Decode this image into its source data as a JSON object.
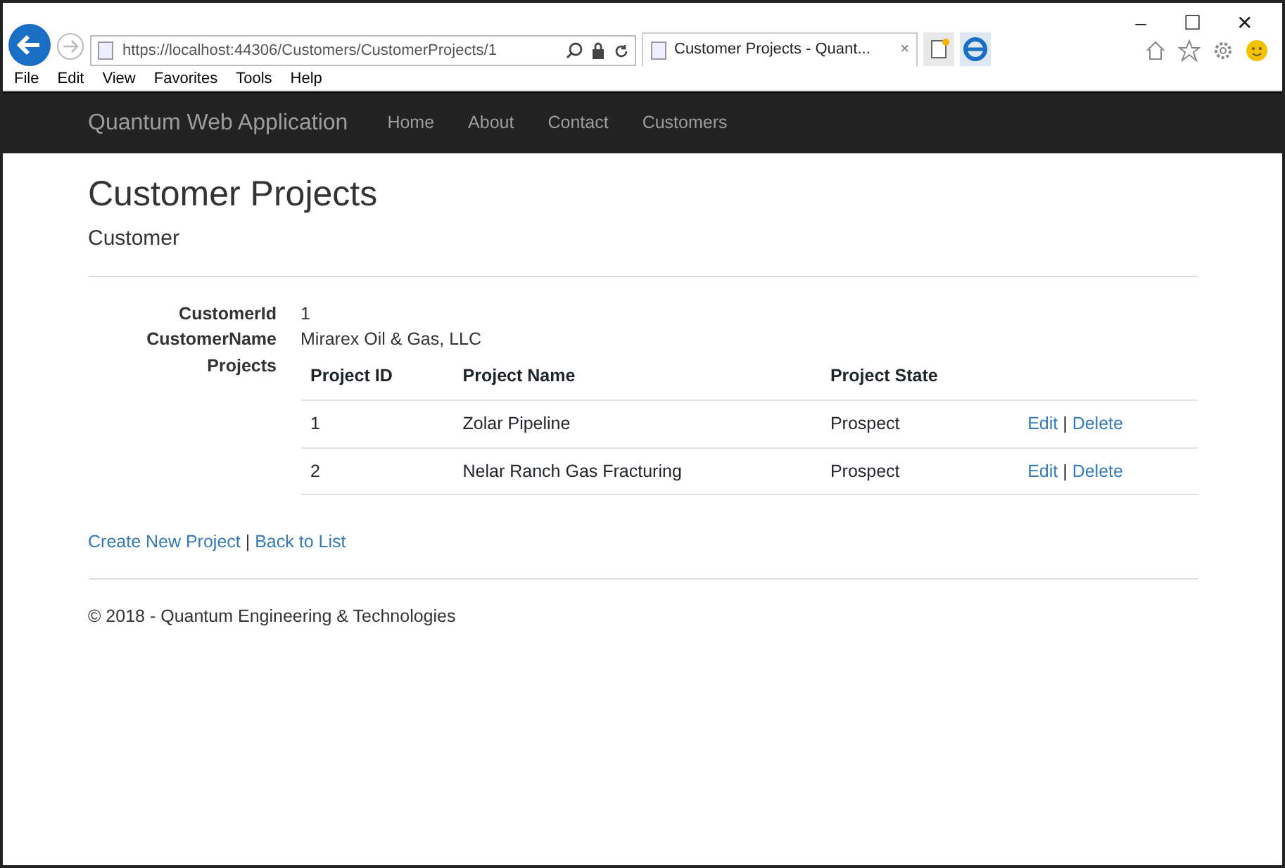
{
  "browser": {
    "address": "https://localhost:44306/Customers/CustomerProjects/1",
    "tab_title": "Customer Projects - Quant...",
    "tab_close": "×",
    "window_controls": [
      "–",
      "☐",
      "✕"
    ],
    "menu": [
      "File",
      "Edit",
      "View",
      "Favorites",
      "Tools",
      "Help"
    ]
  },
  "navbar": {
    "brand": "Quantum Web Application",
    "links": [
      "Home",
      "About",
      "Contact",
      "Customers"
    ]
  },
  "page": {
    "title": "Customer Projects",
    "subtitle": "Customer",
    "fields": [
      {
        "label": "CustomerId",
        "value": "1"
      },
      {
        "label": "CustomerName",
        "value": "Mirarex Oil & Gas, LLC"
      }
    ],
    "projects_label": "Projects",
    "table": {
      "columns": [
        "Project ID",
        "Project Name",
        "Project State"
      ],
      "rows": [
        {
          "cells": [
            "1",
            "Zolar Pipeline",
            "Prospect"
          ],
          "actions": [
            "Edit",
            "Delete"
          ],
          "separator": "|"
        },
        {
          "cells": [
            "2",
            "Nelar Ranch Gas Fracturing",
            "Prospect"
          ],
          "actions": [
            "Edit",
            "Delete"
          ],
          "separator": "|"
        }
      ]
    },
    "links": [
      "Create New Project",
      "Back to List"
    ],
    "links_separator": "|",
    "footer": "© 2018 - Quantum Engineering & Technologies"
  }
}
